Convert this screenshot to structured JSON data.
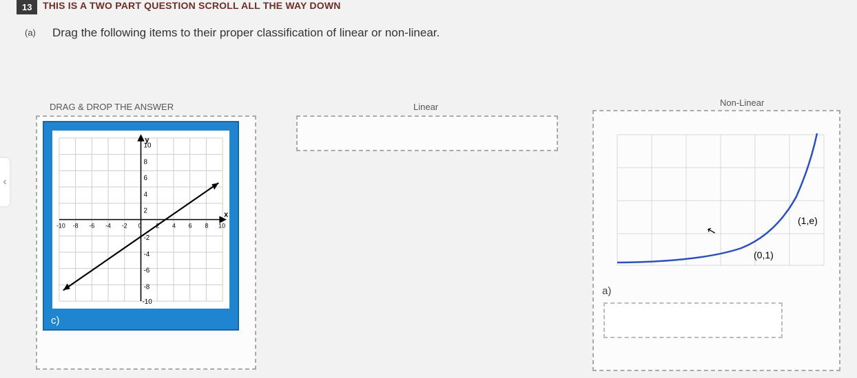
{
  "question": {
    "number": "13",
    "title_banner": "THIS IS A TWO PART QUESTION SCROLL ALL THE WAY DOWN",
    "part": "(a)",
    "prompt": "Drag the following items to their proper classification of linear or non-linear."
  },
  "columns": {
    "drag_header": "DRAG & DROP THE ANSWER",
    "linear_header": "Linear",
    "nonlinear_header": "Non-Linear"
  },
  "cards": {
    "c": {
      "label": "c)",
      "axes": {
        "y_label": "y",
        "x_label": "x",
        "y_ticks": [
          "10",
          "8",
          "6",
          "4",
          "2",
          "-2",
          "-4",
          "-6",
          "-8",
          "-10"
        ],
        "x_ticks": [
          "-10",
          "-8",
          "-6",
          "-4",
          "-2",
          "0",
          "2",
          "4",
          "6",
          "8",
          "10"
        ]
      }
    },
    "a": {
      "label": "a)",
      "point_labels": {
        "p01": "(0,1)",
        "p1e": "(1,e)"
      }
    }
  },
  "chart_data": [
    {
      "id": "card_c",
      "type": "line",
      "title": "",
      "xlabel": "x",
      "ylabel": "y",
      "xlim": [
        -10,
        10
      ],
      "ylim": [
        -10,
        10
      ],
      "series": [
        {
          "name": "linear-line",
          "x": [
            -10,
            10
          ],
          "y": [
            -9,
            5
          ],
          "note": "approx slope 0.7, intercept -2"
        }
      ]
    },
    {
      "id": "card_a",
      "type": "line",
      "title": "",
      "xlabel": "",
      "ylabel": "",
      "xlim": [
        -4,
        2
      ],
      "ylim": [
        0,
        8
      ],
      "series": [
        {
          "name": "exp-curve",
          "x": [
            -4,
            -3,
            -2,
            -1,
            0,
            1,
            1.5,
            2
          ],
          "y": [
            0.02,
            0.05,
            0.14,
            0.37,
            1,
            2.72,
            4.48,
            7.39
          ],
          "labeled_points": [
            {
              "x": 0,
              "y": 1,
              "label": "(0,1)"
            },
            {
              "x": 1,
              "y": 2.718,
              "label": "(1,e)"
            }
          ]
        }
      ]
    }
  ]
}
